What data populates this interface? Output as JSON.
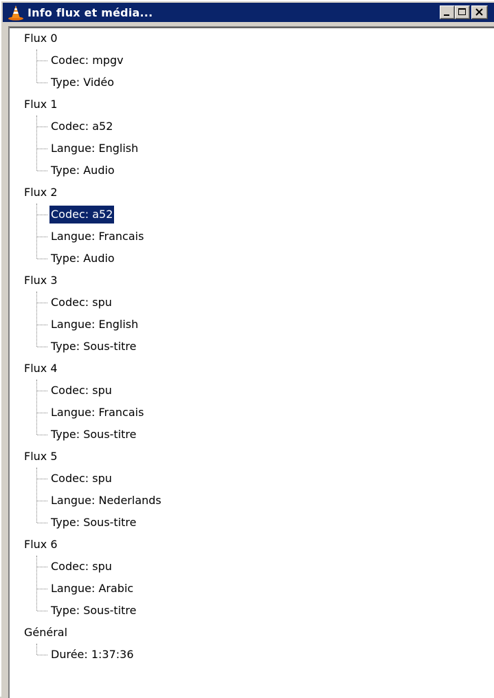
{
  "window": {
    "title": "Info flux et média...",
    "controls": {
      "minimize": "minimize-icon",
      "maximize": "maximize-icon",
      "close": "close-icon"
    }
  },
  "tree": {
    "selected_color": "#0a246a",
    "groups": [
      {
        "label": "Flux 0",
        "items": [
          "Codec: mpgv",
          "Type: Vidéo"
        ]
      },
      {
        "label": "Flux 1",
        "items": [
          "Codec: a52",
          "Langue: English",
          "Type: Audio"
        ]
      },
      {
        "label": "Flux 2",
        "items": [
          "Codec: a52",
          "Langue: Francais",
          "Type: Audio"
        ]
      },
      {
        "label": "Flux 3",
        "items": [
          "Codec: spu",
          "Langue: English",
          "Type: Sous-titre"
        ]
      },
      {
        "label": "Flux 4",
        "items": [
          "Codec: spu",
          "Langue: Francais",
          "Type: Sous-titre"
        ]
      },
      {
        "label": "Flux 5",
        "items": [
          "Codec: spu",
          "Langue: Nederlands",
          "Type: Sous-titre"
        ]
      },
      {
        "label": "Flux 6",
        "items": [
          "Codec: spu",
          "Langue: Arabic",
          "Type: Sous-titre"
        ]
      },
      {
        "label": "Général",
        "items": [
          "Durée: 1:37:36"
        ]
      }
    ],
    "selected": "Flux 2 / Codec: a52"
  }
}
